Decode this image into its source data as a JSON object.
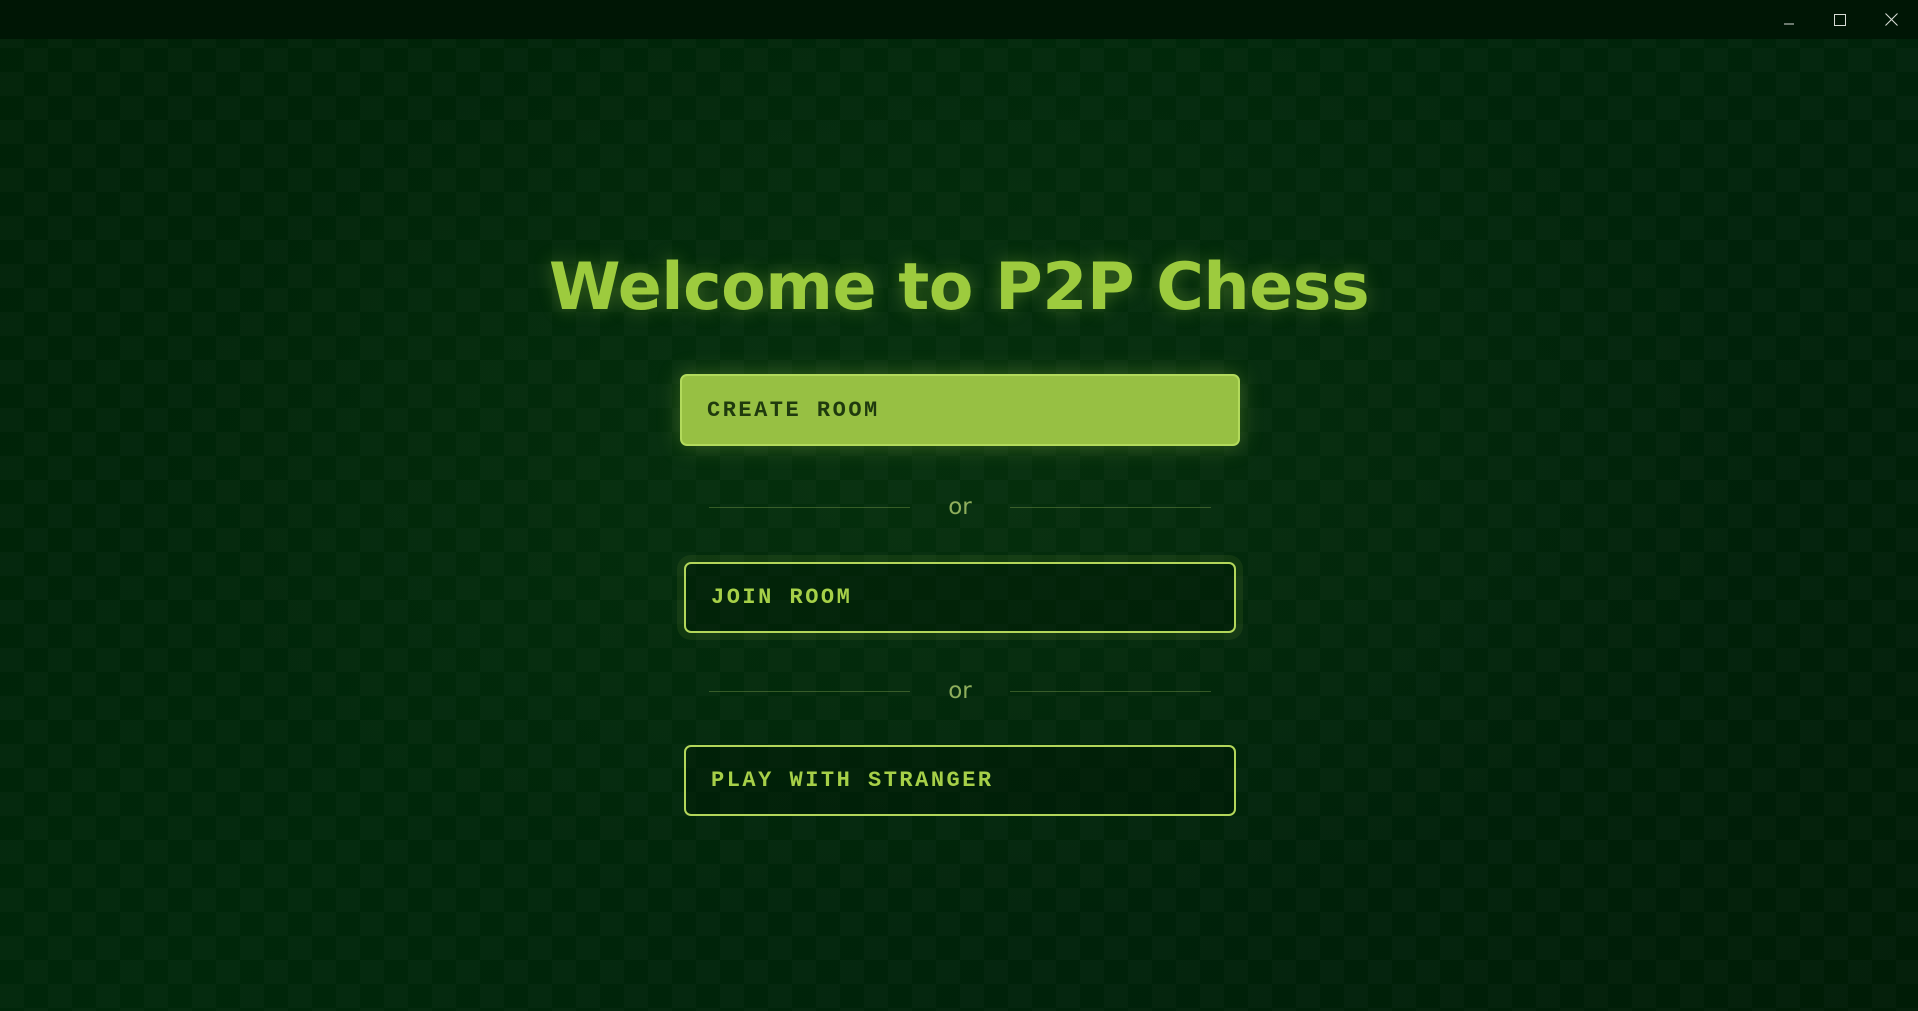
{
  "window_controls": {
    "minimize_icon": "minimize-icon",
    "maximize_icon": "maximize-icon",
    "close_icon": "close-icon"
  },
  "main": {
    "title": "Welcome to P2P Chess",
    "create_room_label": "CREATE ROOM",
    "divider_1_text": "or",
    "join_room_label": "JOIN ROOM",
    "divider_2_text": "or",
    "play_stranger_label": "PLAY WITH STRANGER"
  },
  "colors": {
    "accent": "#97c043",
    "title": "#9dcb3e",
    "background": "#00220a",
    "outline": "#b3d65a"
  }
}
